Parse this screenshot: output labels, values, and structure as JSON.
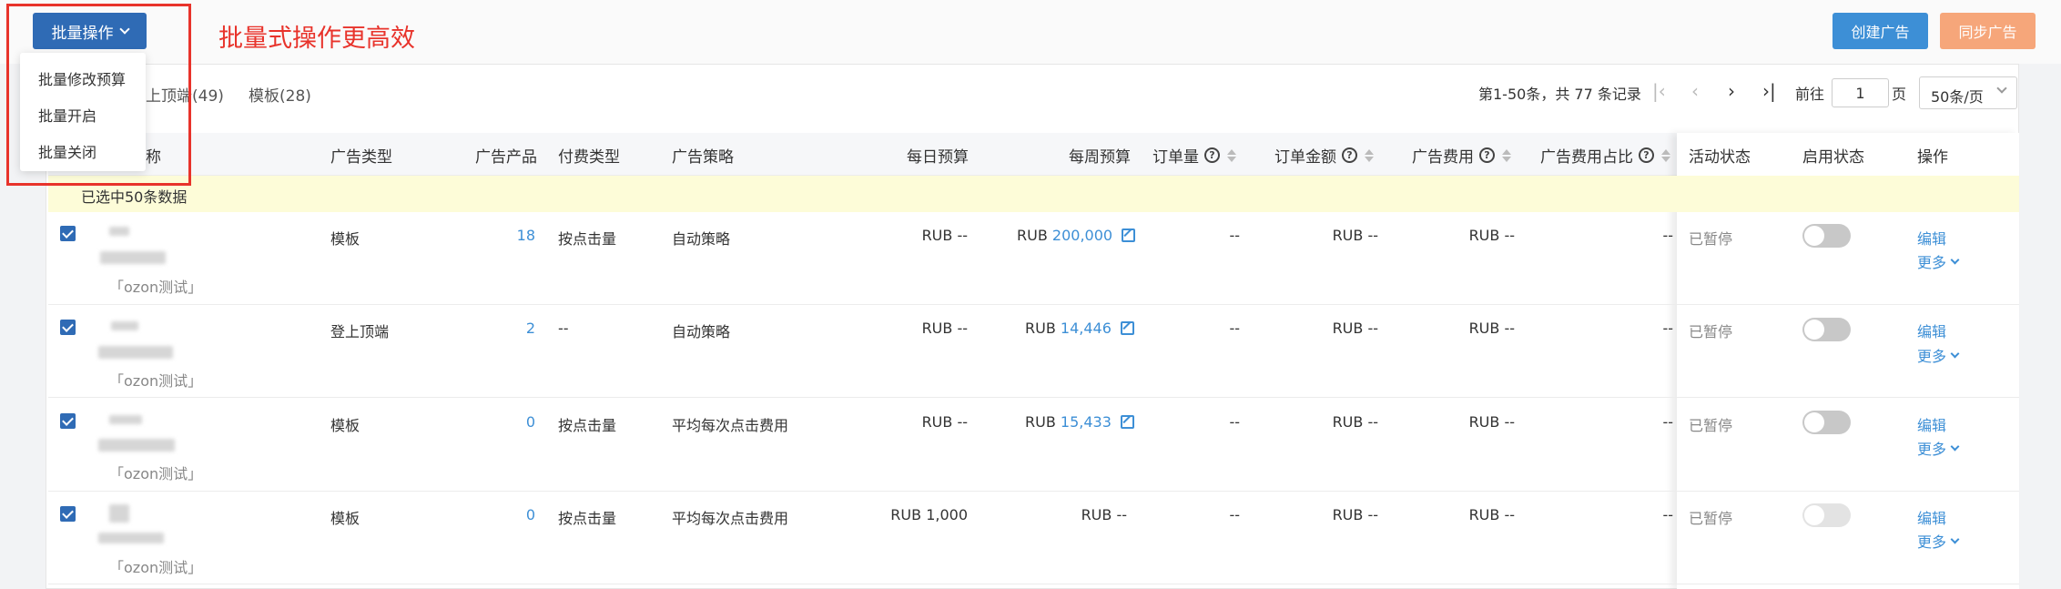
{
  "toolbar": {
    "batch_label": "批量操作",
    "headline": "批量式操作更高效",
    "create_label": "创建广告",
    "sync_label": "同步广告"
  },
  "batch_menu": {
    "items": [
      "批量修改预算",
      "批量开启",
      "批量关闭"
    ]
  },
  "tabs": [
    {
      "label": "上顶端(49)"
    },
    {
      "label": "模板(28)"
    }
  ],
  "pager": {
    "summary": "第1-50条，共 77 条记录",
    "goto_label": "前往",
    "page": "1",
    "page_unit": "页",
    "page_size": "50条/页",
    "icons": [
      "first-page-icon",
      "prev-page-icon",
      "next-page-icon",
      "last-page-icon"
    ]
  },
  "columns": {
    "name": "称",
    "ad_type": "广告类型",
    "products": "广告产品",
    "pay_type": "付费类型",
    "strategy": "广告策略",
    "daily_budget": "每日预算",
    "weekly_budget": "每周预算",
    "orders": "订单量",
    "order_amount": "订单金额",
    "ad_cost": "广告费用",
    "cost_ratio": "广告费用占比",
    "activity_status": "活动状态",
    "enable_status": "启用状态",
    "actions": "操作"
  },
  "selection_text": "已选中50条数据",
  "rows": [
    {
      "tag": "「ozon测试」",
      "ad_type": "模板",
      "products": "18",
      "pay_type": "按点击量",
      "strategy": "自动策略",
      "daily_budget": "RUB --",
      "weekly_currency": "RUB",
      "weekly_value": "200,000",
      "orders": "--",
      "order_amount": "RUB --",
      "ad_cost": "RUB --",
      "cost_ratio": "--",
      "activity_status": "已暂停",
      "edit": "编辑",
      "more": "更多"
    },
    {
      "tag": "「ozon测试」",
      "ad_type": "登上顶端",
      "products": "2",
      "pay_type": "--",
      "strategy": "自动策略",
      "daily_budget": "RUB --",
      "weekly_currency": "RUB",
      "weekly_value": "14,446",
      "orders": "--",
      "order_amount": "RUB --",
      "ad_cost": "RUB --",
      "cost_ratio": "--",
      "activity_status": "已暂停",
      "edit": "编辑",
      "more": "更多"
    },
    {
      "tag": "「ozon测试」",
      "ad_type": "模板",
      "products": "0",
      "pay_type": "按点击量",
      "strategy": "平均每次点击费用",
      "daily_budget": "RUB --",
      "weekly_currency": "RUB",
      "weekly_value": "15,433",
      "orders": "--",
      "order_amount": "RUB --",
      "ad_cost": "RUB --",
      "cost_ratio": "--",
      "activity_status": "已暂停",
      "edit": "编辑",
      "more": "更多"
    },
    {
      "tag": "「ozon测试」",
      "ad_type": "模板",
      "products": "0",
      "pay_type": "按点击量",
      "strategy": "平均每次点击费用",
      "daily_budget": "RUB 1,000",
      "weekly_currency": "RUB --",
      "weekly_value": "",
      "orders": "--",
      "order_amount": "RUB --",
      "ad_cost": "RUB --",
      "cost_ratio": "--",
      "activity_status": "已暂停",
      "edit": "编辑",
      "more": "更多"
    }
  ]
}
